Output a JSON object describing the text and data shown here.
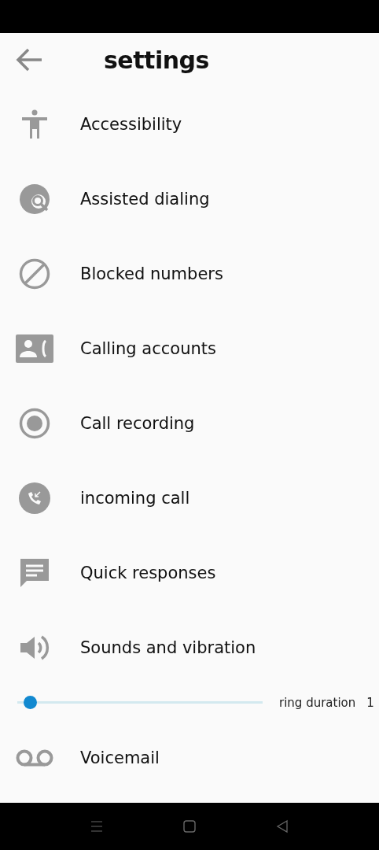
{
  "header": {
    "title": "settings"
  },
  "items": [
    {
      "kind": "entry",
      "label": "Accessibility"
    },
    {
      "kind": "entry",
      "label": "Assisted dialing"
    },
    {
      "kind": "entry",
      "label": "Blocked numbers"
    },
    {
      "kind": "entry",
      "label": "Calling accounts"
    },
    {
      "kind": "entry",
      "label": "Call recording"
    },
    {
      "kind": "entry",
      "label": "incoming call"
    },
    {
      "kind": "entry",
      "label": "Quick responses"
    },
    {
      "kind": "entry",
      "label": "Sounds and vibration"
    },
    {
      "kind": "slider",
      "level": 0.03,
      "label": "ring duration",
      "reading": "1"
    },
    {
      "kind": "entry",
      "label": "Voicemail"
    }
  ]
}
